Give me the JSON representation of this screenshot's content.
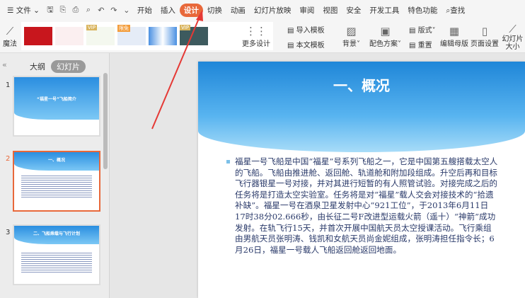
{
  "menubar": {
    "file": "文件",
    "tabs": [
      "开始",
      "插入",
      "设计",
      "切换",
      "动画",
      "幻灯片放映",
      "审阅",
      "视图",
      "安全",
      "开发工具",
      "特色功能"
    ],
    "active_tab": "设计",
    "search": "查找"
  },
  "ribbon": {
    "magic": "魔法",
    "more_design": "更多设计",
    "import_template": "导入模板",
    "body_template": "本文模板",
    "background": "背景",
    "color_scheme": "配色方案",
    "layout": "版式",
    "reset": "重置",
    "edit_master": "编辑母版",
    "page_setup": "页面设置",
    "slide_size": "幻灯片大小",
    "badges": {
      "vip": "VIP",
      "new": "限免"
    }
  },
  "left_panel": {
    "outline_tab": "大纲",
    "slides_tab": "幻灯片",
    "thumbnails": [
      {
        "num": "1",
        "title": "“福星一号”飞船简介"
      },
      {
        "num": "2",
        "title": "一、概况"
      },
      {
        "num": "3",
        "title": "二、飞船乘载与飞行计划"
      }
    ],
    "selected": 2
  },
  "slide": {
    "title": "一、概况",
    "body": "福星一号飞船是中国“福星”号系列飞船之一，它是中国第五艘搭载太空人的飞船。飞船由推进舱、返回舱、轨道舱和附加段组成。升空后再和目标飞行器银星一号对接，并对其进行短暂的有人照管试验。对接完成之后的任务将是打造太空实验室。任务将是对“福星”载人交会对接技术的“拾遗补缺”。福星一号在酒泉卫星发射中心“921工位”，于2013年6月11日17时38分02.666秒，由长征二号F改进型运载火箭（遥十）“神箭”成功发射。在轨飞行15天，并首次开展中国航天员太空授课活动。飞行乘组由男航天员张明涛、钱凯和女航天员尚金妮组成，张明涛担任指令长；6月26日，福星一号载人飞船返回舱返回地面。"
  },
  "colors": {
    "accent": "#e8683a",
    "slide_blue": "#1f86d8",
    "arrow": "#e53935"
  }
}
